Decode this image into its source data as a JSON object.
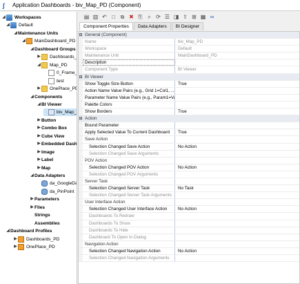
{
  "window": {
    "title": "Application Dashboards - biv_Map_PD (Component)"
  },
  "tree": [
    {
      "label": "Workspaces",
      "toggle": "◢",
      "icon": "ws",
      "bold": true,
      "level": 0
    },
    {
      "label": "Default",
      "toggle": "◢",
      "icon": "ws",
      "bold": false,
      "level": 1
    },
    {
      "label": "Maintenance Units",
      "toggle": "◢",
      "icon": "",
      "bold": true,
      "level": 2
    },
    {
      "label": "MainDashboard_PD",
      "toggle": "◢",
      "icon": "orange",
      "bold": false,
      "level": 3
    },
    {
      "label": "Dashboard Groups",
      "toggle": "◢",
      "icon": "",
      "bold": true,
      "level": 4
    },
    {
      "label": "Dashboards_PD",
      "toggle": "▶",
      "icon": "folder",
      "bold": false,
      "level": 5
    },
    {
      "label": "Map_PD",
      "toggle": "◢",
      "icon": "folder",
      "bold": false,
      "level": 5
    },
    {
      "label": "0_Frame_Map",
      "toggle": "",
      "icon": "doc",
      "bold": false,
      "level": 6
    },
    {
      "label": "test",
      "toggle": "",
      "icon": "doc",
      "bold": false,
      "level": 6
    },
    {
      "label": "OnePlace_PD",
      "toggle": "▶",
      "icon": "folder",
      "bold": false,
      "level": 5
    },
    {
      "label": "Components",
      "toggle": "◢",
      "icon": "",
      "bold": true,
      "level": 4
    },
    {
      "label": "BI Viewer",
      "toggle": "◢",
      "icon": "",
      "bold": true,
      "level": 5
    },
    {
      "label": "biv_Map_PD",
      "toggle": "",
      "icon": "comp",
      "bold": false,
      "level": 6,
      "selected": true
    },
    {
      "label": "Button",
      "toggle": "▶",
      "icon": "",
      "bold": true,
      "level": 5
    },
    {
      "label": "Combo Box",
      "toggle": "▶",
      "icon": "",
      "bold": true,
      "level": 5
    },
    {
      "label": "Cube View",
      "toggle": "▶",
      "icon": "",
      "bold": true,
      "level": 5
    },
    {
      "label": "Embedded Dashbo",
      "toggle": "▶",
      "icon": "",
      "bold": true,
      "level": 5
    },
    {
      "label": "Image",
      "toggle": "▶",
      "icon": "",
      "bold": true,
      "level": 5
    },
    {
      "label": "Label",
      "toggle": "▶",
      "icon": "",
      "bold": true,
      "level": 5
    },
    {
      "label": "Map",
      "toggle": "▶",
      "icon": "",
      "bold": true,
      "level": 5
    },
    {
      "label": "Data Adapters",
      "toggle": "◢",
      "icon": "",
      "bold": true,
      "level": 4
    },
    {
      "label": "da_GoogleData",
      "toggle": "",
      "icon": "db",
      "bold": false,
      "level": 5
    },
    {
      "label": "da_PinPoint",
      "toggle": "",
      "icon": "db",
      "bold": false,
      "level": 5
    },
    {
      "label": "Parameters",
      "toggle": "▶",
      "icon": "",
      "bold": true,
      "level": 4
    },
    {
      "label": "Files",
      "toggle": "▶",
      "icon": "",
      "bold": true,
      "level": 4
    },
    {
      "label": "Strings",
      "toggle": "",
      "icon": "",
      "bold": true,
      "level": 4
    },
    {
      "label": "Assemblies",
      "toggle": "",
      "icon": "",
      "bold": true,
      "level": 4
    },
    {
      "label": "Dashboard Profiles",
      "toggle": "◢",
      "icon": "",
      "bold": true,
      "level": 1
    },
    {
      "label": "Dashboards_PD",
      "toggle": "▶",
      "icon": "orange",
      "bold": false,
      "level": 2
    },
    {
      "label": "OnePlace_PD",
      "toggle": "▶",
      "icon": "orange",
      "bold": false,
      "level": 2
    }
  ],
  "toolbar": [
    {
      "name": "save-icon",
      "glyph": "▤",
      "tone": ""
    },
    {
      "name": "save-all-icon",
      "glyph": "▥",
      "tone": ""
    },
    {
      "name": "undo-icon",
      "glyph": "↶",
      "tone": ""
    },
    {
      "name": "new-icon",
      "glyph": "□",
      "tone": ""
    },
    {
      "name": "copy-icon",
      "glyph": "⧉",
      "tone": ""
    },
    {
      "name": "delete-icon",
      "glyph": "✖",
      "tone": "red"
    },
    {
      "name": "rename-icon",
      "glyph": "⎘",
      "tone": ""
    },
    {
      "name": "search-icon",
      "glyph": "⌕",
      "tone": ""
    },
    {
      "name": "refresh-icon",
      "glyph": "⟳",
      "tone": ""
    },
    {
      "name": "view-icon",
      "glyph": "☰",
      "tone": ""
    },
    {
      "name": "run-icon",
      "glyph": "◨",
      "tone": ""
    },
    {
      "name": "export-icon",
      "glyph": "⇪",
      "tone": ""
    },
    {
      "name": "add-icon",
      "glyph": "⊞",
      "tone": ""
    },
    {
      "name": "properties-icon",
      "glyph": "▦",
      "tone": ""
    },
    {
      "name": "designer-icon",
      "glyph": "∞",
      "tone": "blue"
    }
  ],
  "tabs": [
    {
      "label": "Component Properties",
      "active": true
    },
    {
      "label": "Data Adapters",
      "active": false
    },
    {
      "label": "BI Designer",
      "active": false
    }
  ],
  "properties": [
    {
      "kind": "cat",
      "name": "General (Component)",
      "value": ""
    },
    {
      "kind": "prop",
      "name": "Name",
      "value": "biv_Map_PD",
      "dis": true
    },
    {
      "kind": "prop",
      "name": "Workspace",
      "value": "Default",
      "dis": true
    },
    {
      "kind": "prop",
      "name": "Maintenance Unit",
      "value": "MainDashboard_PD",
      "dis": true
    },
    {
      "kind": "prop",
      "name": "Description",
      "value": "",
      "dashed": true
    },
    {
      "kind": "prop",
      "name": "Component Type",
      "value": "BI Viewer",
      "dis": true
    },
    {
      "kind": "cat",
      "name": "BI Viewer",
      "value": ""
    },
    {
      "kind": "prop",
      "name": "Show Toggle Size Button",
      "value": "True"
    },
    {
      "kind": "prop",
      "name": "Action Name Value Pairs (e.g., Grid 1=Col1, ...)",
      "value": ""
    },
    {
      "kind": "prop",
      "name": "Parameter Name Value Pairs (e.g., Param1=Value1, ...)",
      "value": ""
    },
    {
      "kind": "prop",
      "name": "Palette Colors",
      "value": ""
    },
    {
      "kind": "prop",
      "name": "Show Borders",
      "value": "True"
    },
    {
      "kind": "cat",
      "name": "Action",
      "value": ""
    },
    {
      "kind": "prop",
      "name": "Bound Parameter",
      "value": ""
    },
    {
      "kind": "prop",
      "name": "Apply Selected Value To Current Dashboard",
      "value": "True"
    },
    {
      "kind": "sub",
      "name": "Save Action",
      "value": ""
    },
    {
      "kind": "ind",
      "name": "Selection Changed Save Action",
      "value": "No Action"
    },
    {
      "kind": "ind",
      "name": "Selection Changed Save Arguments",
      "value": "",
      "dis": true
    },
    {
      "kind": "sub",
      "name": "POV Action",
      "value": ""
    },
    {
      "kind": "ind",
      "name": "Selection Changed POV Action",
      "value": "No Action"
    },
    {
      "kind": "ind",
      "name": "Selection Changed POV Arguments",
      "value": "",
      "dis": true
    },
    {
      "kind": "sub",
      "name": "Server Task",
      "value": ""
    },
    {
      "kind": "ind",
      "name": "Selection Changed Server Task",
      "value": "No Task"
    },
    {
      "kind": "ind",
      "name": "Selection Changed Server Task Arguments",
      "value": "",
      "dis": true
    },
    {
      "kind": "sub",
      "name": "User Interface Action",
      "value": ""
    },
    {
      "kind": "ind",
      "name": "Selection Changed User Interface Action",
      "value": "No Action"
    },
    {
      "kind": "ind",
      "name": "Dashboards To Redraw",
      "value": "",
      "dis": true
    },
    {
      "kind": "ind",
      "name": "Dashboards To Show",
      "value": "",
      "dis": true
    },
    {
      "kind": "ind",
      "name": "Dashboards To Hide",
      "value": "",
      "dis": true
    },
    {
      "kind": "ind",
      "name": "Dashboard To Open In Dialog",
      "value": "",
      "dis": true
    },
    {
      "kind": "sub",
      "name": "Navigation Action",
      "value": ""
    },
    {
      "kind": "ind",
      "name": "Selection Changed Navigation Action",
      "value": "No Action"
    },
    {
      "kind": "ind",
      "name": "Selection Changed Navigation Arguments",
      "value": "",
      "dis": true
    }
  ]
}
